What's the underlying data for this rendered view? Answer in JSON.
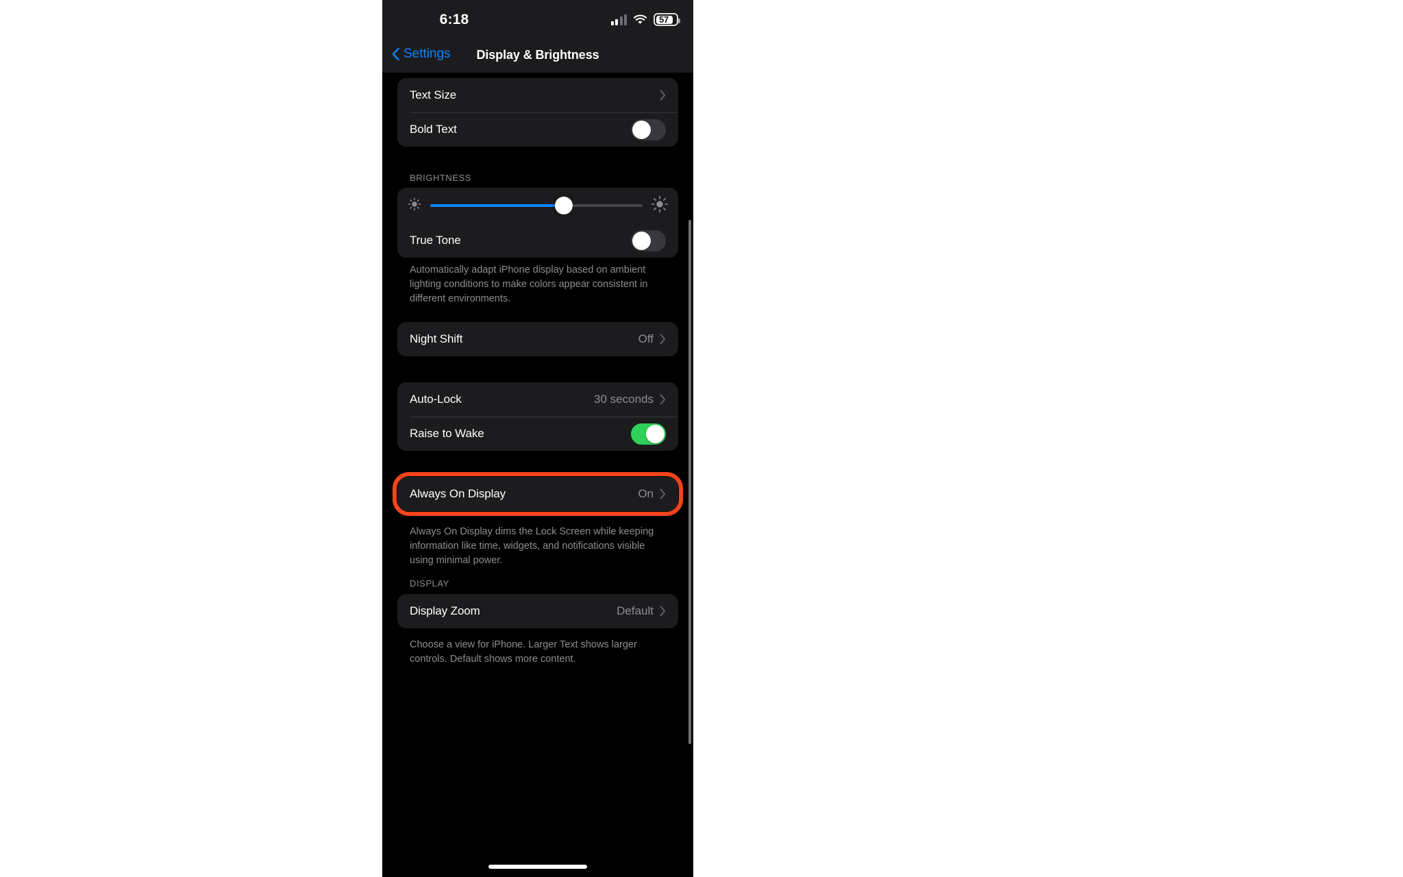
{
  "status_bar": {
    "time": "6:18",
    "battery_percent": "57",
    "cellular_icon": "cellular-bars-icon",
    "wifi_icon": "wifi-icon",
    "battery_icon": "battery-icon"
  },
  "nav_bar": {
    "back_label": "Settings",
    "back_icon": "chevron-left-icon",
    "title": "Display & Brightness"
  },
  "groups": {
    "text": {
      "rows": [
        {
          "label": "Text Size",
          "value": "",
          "accessory": "chevron"
        },
        {
          "label": "Bold Text",
          "value": "",
          "accessory": "toggle",
          "toggle_on": false
        }
      ]
    },
    "brightness": {
      "header": "BRIGHTNESS",
      "slider": {
        "value_percent": 63,
        "min_icon": "brightness-low-sun-icon",
        "max_icon": "brightness-high-sun-icon",
        "fill_color": "#0a84ff",
        "track_color": "#48484a"
      },
      "rows": [
        {
          "label": "True Tone",
          "value": "",
          "accessory": "toggle",
          "toggle_on": false
        }
      ],
      "footer": "Automatically adapt iPhone display based on ambient lighting conditions to make colors appear consistent in different environments."
    },
    "night_shift": {
      "rows": [
        {
          "label": "Night Shift",
          "value": "Off",
          "accessory": "chevron"
        }
      ]
    },
    "lock": {
      "rows": [
        {
          "label": "Auto-Lock",
          "value": "30 seconds",
          "accessory": "chevron"
        },
        {
          "label": "Raise to Wake",
          "value": "",
          "accessory": "toggle",
          "toggle_on": true
        }
      ]
    },
    "always_on": {
      "rows": [
        {
          "label": "Always On Display",
          "value": "On",
          "accessory": "chevron"
        }
      ],
      "footer": "Always On Display dims the Lock Screen while keeping information like time, widgets, and notifications visible using minimal power.",
      "highlight_color": "#f4441c"
    },
    "display": {
      "header": "DISPLAY",
      "rows": [
        {
          "label": "Display Zoom",
          "value": "Default",
          "accessory": "chevron"
        }
      ],
      "footer": "Choose a view for iPhone. Larger Text shows larger controls. Default shows more content."
    }
  }
}
